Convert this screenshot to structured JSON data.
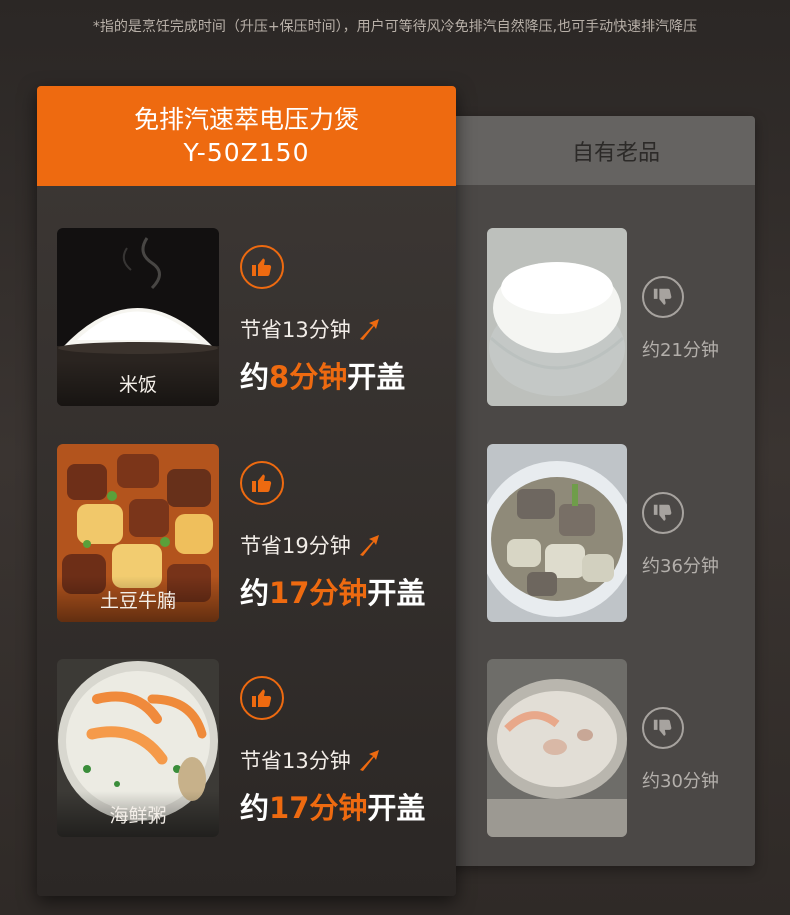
{
  "note": "*指的是烹饪完成时间（升压+保压时间），用户可等待风冷免排汽自然降压,也可手动快速排汽降压",
  "new_product": {
    "title_line1": "免排汽速萃电压力煲",
    "title_line2": "Y-50Z150",
    "rows": [
      {
        "dish": "米饭",
        "saved_text": "节省13分钟",
        "lid_prefix": "约",
        "lid_time": "8分钟",
        "lid_suffix": "开盖",
        "icon": "thumbs-up-icon"
      },
      {
        "dish": "土豆牛腩",
        "saved_text": "节省19分钟",
        "lid_prefix": "约",
        "lid_time": "17分钟",
        "lid_suffix": "开盖",
        "icon": "thumbs-up-icon"
      },
      {
        "dish": "海鲜粥",
        "saved_text": "节省13分钟",
        "lid_prefix": "约",
        "lid_time": "17分钟",
        "lid_suffix": "开盖",
        "icon": "thumbs-up-icon"
      }
    ]
  },
  "old_product": {
    "title": "自有老品",
    "rows": [
      {
        "time": "约21分钟",
        "icon": "thumbs-down-icon"
      },
      {
        "time": "约36分钟",
        "icon": "thumbs-down-icon"
      },
      {
        "time": "约30分钟",
        "icon": "thumbs-down-icon"
      }
    ]
  },
  "colors": {
    "accent": "#ee6a10",
    "old_header": "#656361",
    "old_card": "#4b4846",
    "background": "#2f2a27"
  }
}
